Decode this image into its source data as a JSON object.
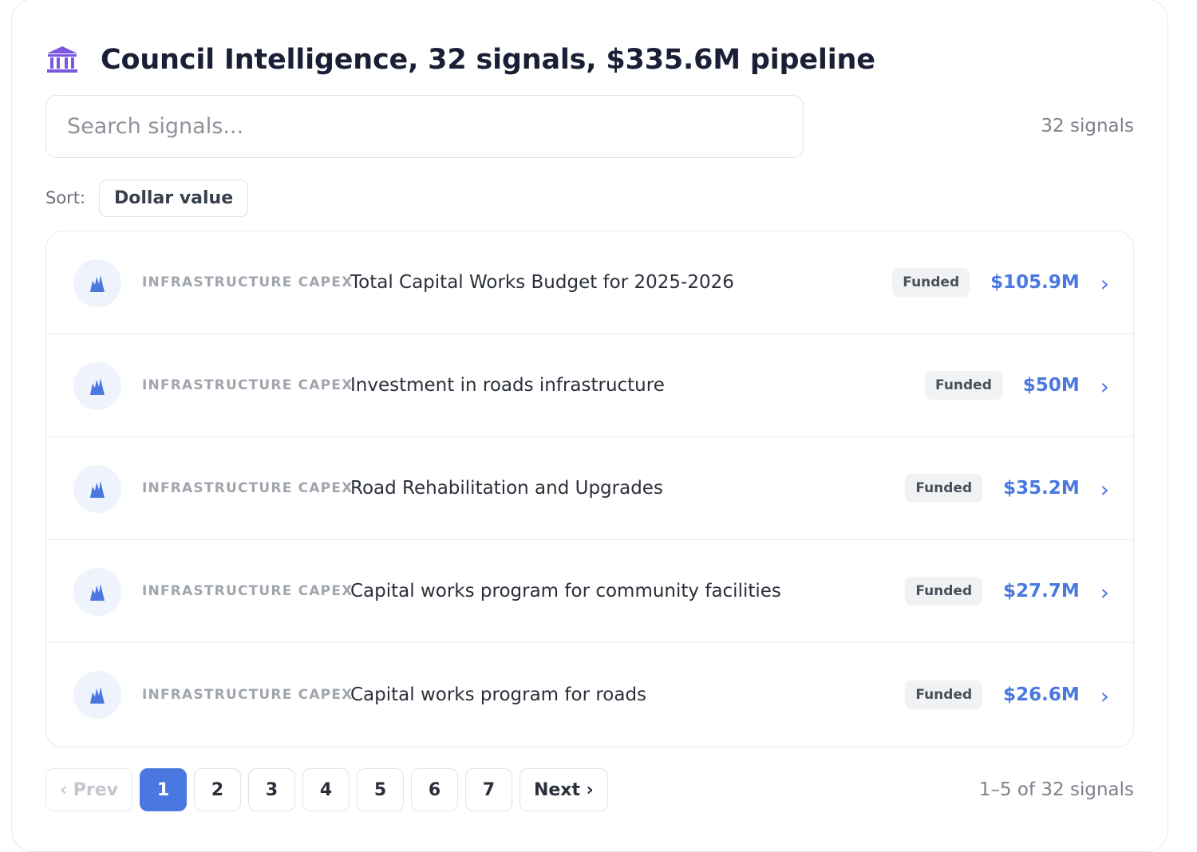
{
  "header": {
    "icon": "bank-icon",
    "title": "Council Intelligence, 32 signals, $335.6M pipeline"
  },
  "search": {
    "placeholder": "Search signals...",
    "value": "",
    "count": "32 signals"
  },
  "sort": {
    "label": "Sort:",
    "value": "Dollar value"
  },
  "colors": {
    "accent": "#4a78e0",
    "header_icon": "#7b57e0",
    "row_icon": "#4a78e0"
  },
  "signals": [
    {
      "icon": "infrastructure-icon",
      "category": "INFRASTRUCTURE CAPEX",
      "title": "Total Capital Works Budget for 2025-2026",
      "status": "Funded",
      "amount": "$105.9M"
    },
    {
      "icon": "infrastructure-icon",
      "category": "INFRASTRUCTURE CAPEX",
      "title": "Investment in roads infrastructure",
      "status": "Funded",
      "amount": "$50M"
    },
    {
      "icon": "infrastructure-icon",
      "category": "INFRASTRUCTURE CAPEX",
      "title": "Road Rehabilitation and Upgrades",
      "status": "Funded",
      "amount": "$35.2M"
    },
    {
      "icon": "infrastructure-icon",
      "category": "INFRASTRUCTURE CAPEX",
      "title": "Capital works program for community facilities",
      "status": "Funded",
      "amount": "$27.7M"
    },
    {
      "icon": "infrastructure-icon",
      "category": "INFRASTRUCTURE CAPEX",
      "title": "Capital works program for roads",
      "status": "Funded",
      "amount": "$26.6M"
    }
  ],
  "pagination": {
    "prev_label": "‹ Prev",
    "pages": [
      "1",
      "2",
      "3",
      "4",
      "5",
      "6",
      "7"
    ],
    "current_page": "1",
    "next_label": "Next ›",
    "summary": "1–5 of 32 signals"
  }
}
